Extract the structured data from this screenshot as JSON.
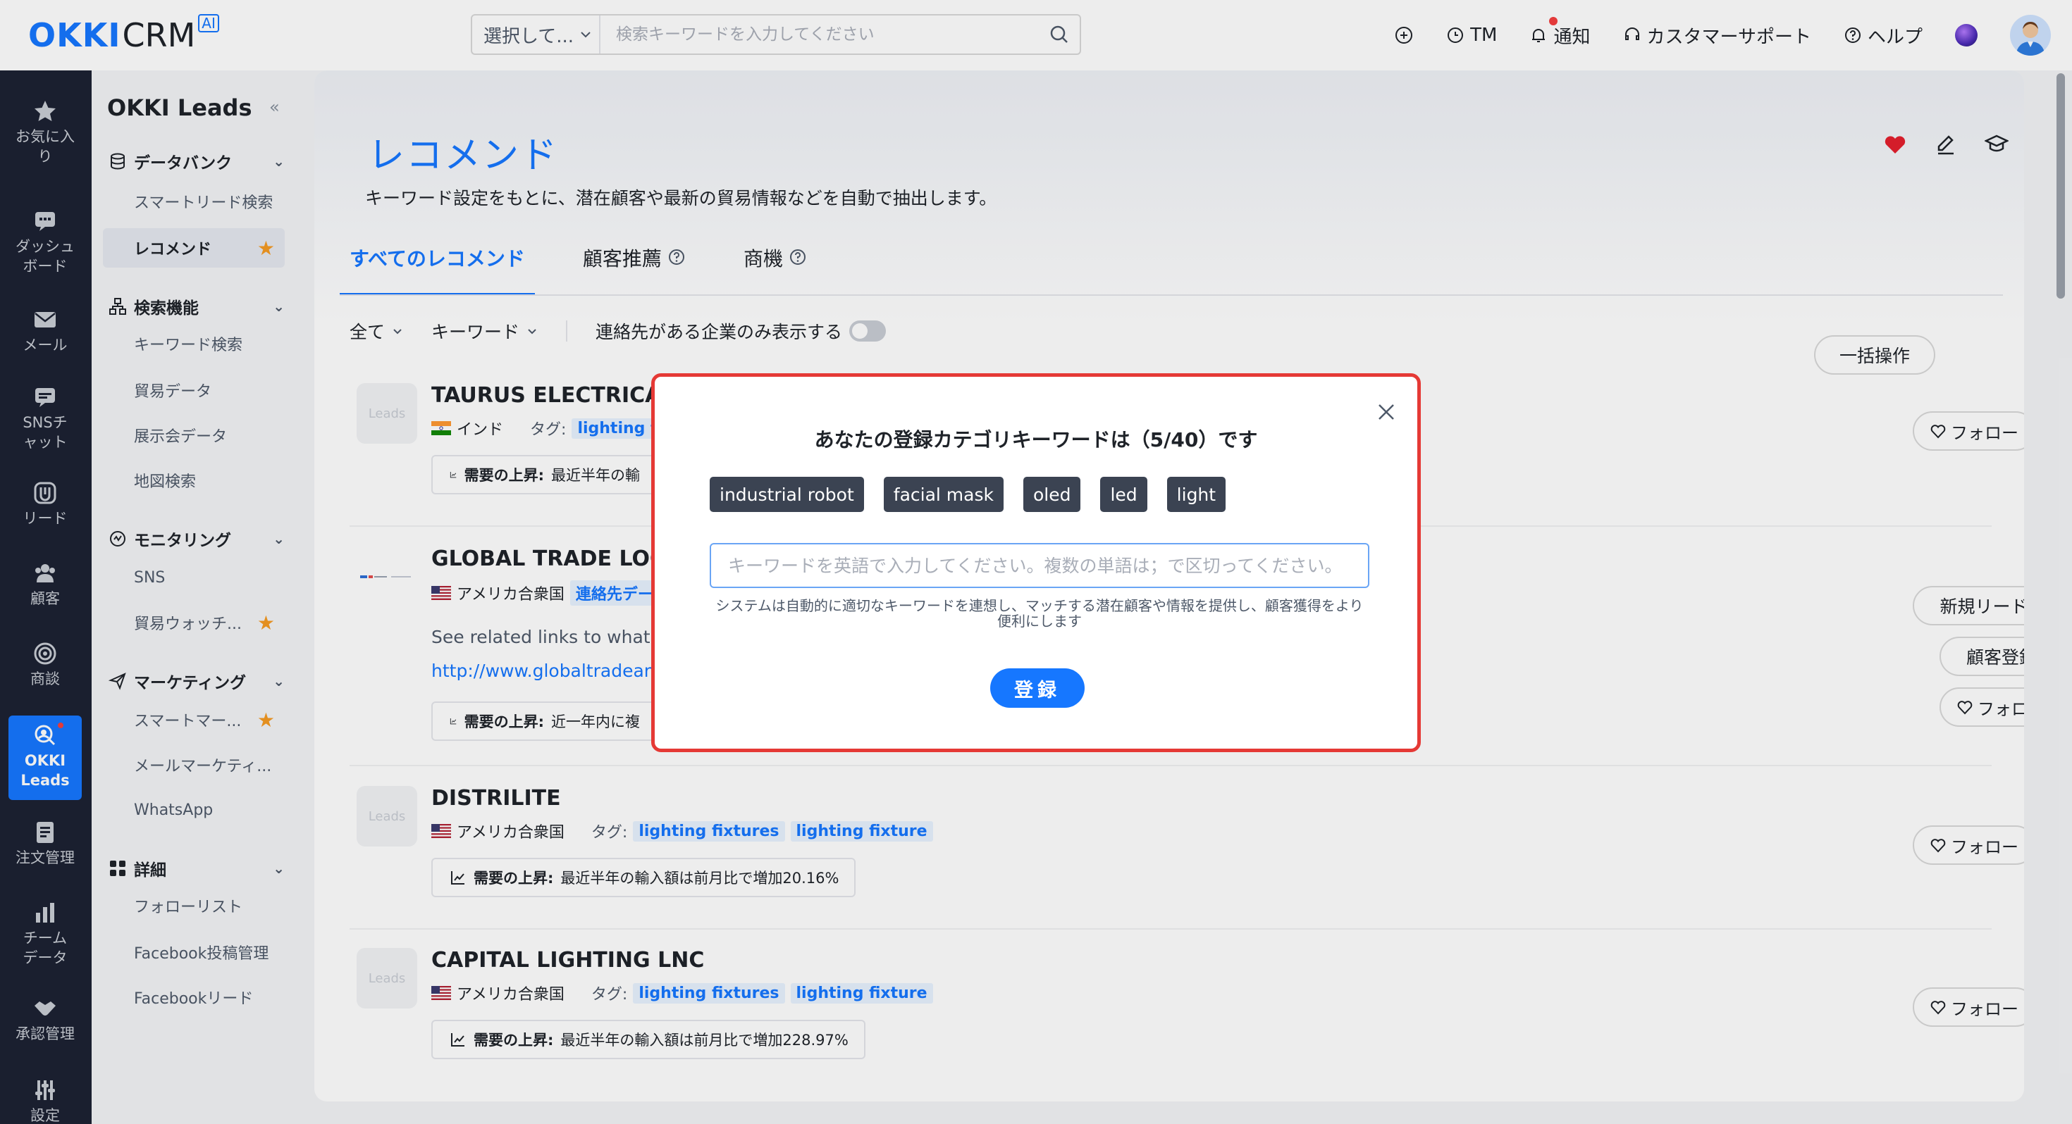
{
  "topbar": {
    "logo_okki": "OKKI",
    "logo_crm": "CRM",
    "logo_ai": "AI",
    "search_select": "選択して...",
    "search_placeholder": "検索キーワードを入力してください",
    "actions": {
      "tm": "TM",
      "notify": "通知",
      "support": "カスタマーサポート",
      "help": "ヘルプ"
    }
  },
  "leftnav": {
    "items": [
      {
        "label": "お気に入り",
        "icon": "star-icon"
      },
      {
        "label": "ダッシュボード",
        "icon": "dashboard-icon"
      },
      {
        "label": "メール",
        "icon": "mail-icon"
      },
      {
        "label": "SNSチャット",
        "icon": "chat-icon"
      },
      {
        "label": "リード",
        "icon": "leads-icon"
      },
      {
        "label": "顧客",
        "icon": "customers-icon"
      },
      {
        "label": "商談",
        "icon": "target-icon"
      },
      {
        "label": "OKKI Leads",
        "icon": "okki-leads-icon"
      },
      {
        "label": "注文管理",
        "icon": "order-icon"
      },
      {
        "label": "チームデータ",
        "icon": "bar-chart-icon"
      },
      {
        "label": "承認管理",
        "icon": "handshake-icon"
      },
      {
        "label": "設定",
        "icon": "settings-icon"
      }
    ]
  },
  "sidebar": {
    "title": "OKKI Leads",
    "collapse": "«",
    "sections": [
      {
        "label": "データバンク",
        "items": [
          "スマートリード検索",
          "レコメンド"
        ]
      },
      {
        "label": "検索機能",
        "items": [
          "キーワード検索",
          "貿易データ",
          "展示会データ",
          "地図検索"
        ]
      },
      {
        "label": "モニタリング",
        "items": [
          "SNS",
          "貿易ウォッチ..."
        ]
      },
      {
        "label": "マーケティング",
        "items": [
          "スマートマー...",
          "メールマーケティ...",
          "WhatsApp"
        ]
      },
      {
        "label": "詳細",
        "items": [
          "フォローリスト",
          "Facebook投稿管理",
          "Facebookリード"
        ]
      }
    ]
  },
  "main": {
    "title": "レコメンド",
    "description": "キーワード設定をもとに、潜在顧客や最新の貿易情報などを自動で抽出します。",
    "tabs": [
      "すべてのレコメンド",
      "顧客推薦",
      "商機"
    ],
    "filters": {
      "all": "全て",
      "keyword": "キーワード",
      "contact_only": "連絡先がある企業のみ表示する"
    },
    "bulk_action": "一括操作",
    "follow_label": "フォロー",
    "new_lead": "新規リード登録",
    "register_customer": "顧客登録",
    "logo_placeholder": "Leads",
    "tag_label": "タグ:",
    "insight_label": "需要の上昇:",
    "companies": [
      {
        "name": "TAURUS ELECTRICAL II",
        "country": "インド",
        "tags": [
          "lighting fi"
        ],
        "insight": "最近半年の輸"
      },
      {
        "name": "GLOBAL TRADE LOGIST",
        "country": "アメリカ合衆国",
        "contact_link": "連絡先データ",
        "text": "See related links to what yo",
        "url": "http://www.globaltradeandl",
        "insight": "近一年内に複"
      },
      {
        "name": "DISTRILITE",
        "country": "アメリカ合衆国",
        "tags": [
          "lighting fixtures",
          "lighting fixture"
        ],
        "insight": "最近半年の輸入額は前月比で増加20.16%"
      },
      {
        "name": "CAPITAL LIGHTING LNC",
        "country": "アメリカ合衆国",
        "tags": [
          "lighting fixtures",
          "lighting fixture"
        ],
        "insight": "最近半年の輸入額は前月比で増加228.97%"
      }
    ]
  },
  "modal": {
    "title": "あなたの登録カテゴリキーワードは（5/40）です",
    "keywords": [
      "industrial robot",
      "facial mask",
      "oled",
      "led",
      "light"
    ],
    "input_placeholder": "キーワードを英語で入力してください。複数の単語は；で区切ってください。",
    "hint": "システムは自動的に適切なキーワードを連想し、マッチする潜在顧客や情報を提供し、顧客獲得をより便利にします",
    "submit": "登録"
  },
  "colors": {
    "accent": "#1677ff",
    "nav_bg": "#1c2233",
    "modal_border": "#e53935",
    "keyword_chip": "#3b4352",
    "star": "#f59a23",
    "heart": "#e5202e"
  }
}
